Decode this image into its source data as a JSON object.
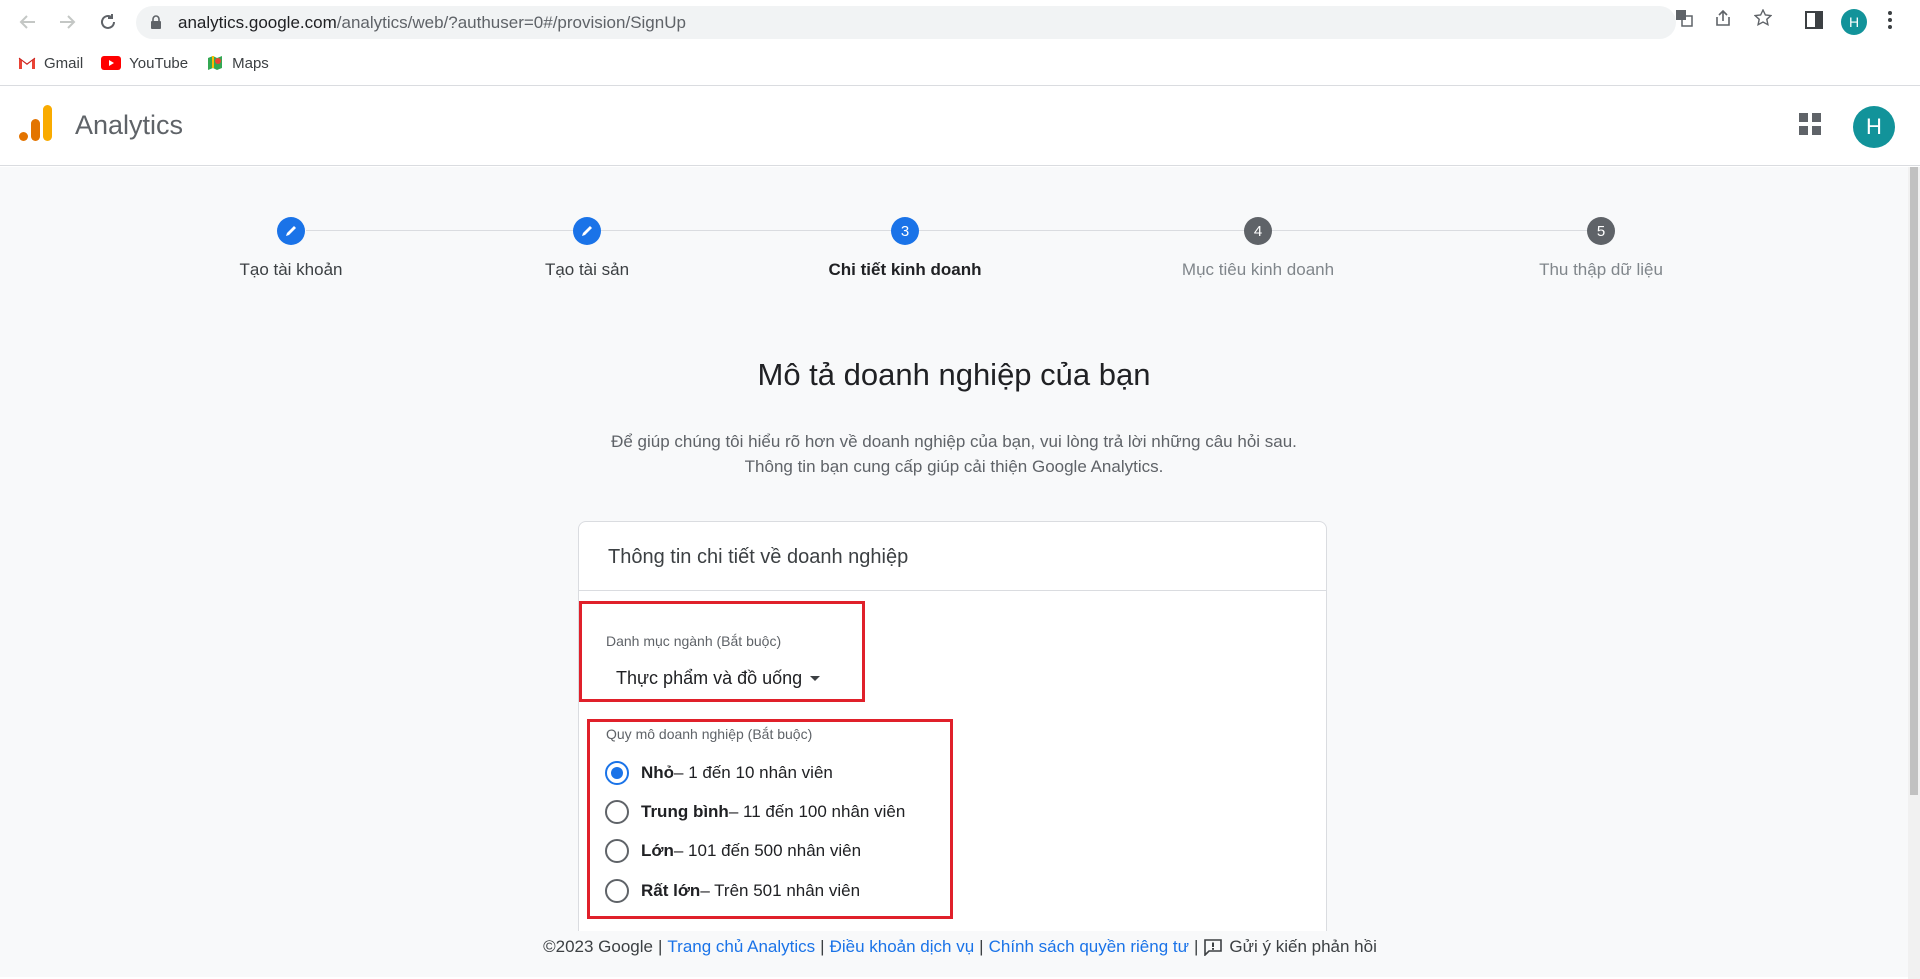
{
  "browser": {
    "url_host": "analytics.google.com",
    "url_path": "/analytics/web/?authuser=0#/provision/SignUp",
    "profile_initial": "H",
    "bookmarks": [
      {
        "label": "Gmail",
        "icon": "gmail-icon"
      },
      {
        "label": "YouTube",
        "icon": "youtube-icon"
      },
      {
        "label": "Maps",
        "icon": "maps-icon"
      }
    ]
  },
  "app": {
    "title": "Analytics",
    "avatar_initial": "H"
  },
  "stepper": {
    "steps": [
      {
        "label": "Tạo tài khoản",
        "state": "done"
      },
      {
        "label": "Tạo tài sản",
        "state": "done"
      },
      {
        "number": "3",
        "label": "Chi tiết kinh doanh",
        "state": "active"
      },
      {
        "number": "4",
        "label": "Mục tiêu kinh doanh",
        "state": "future"
      },
      {
        "number": "5",
        "label": "Thu thập dữ liệu",
        "state": "future"
      }
    ]
  },
  "page": {
    "heading": "Mô tả doanh nghiệp của bạn",
    "subtext_line1": "Để giúp chúng tôi hiểu rõ hơn về doanh nghiệp của bạn, vui lòng trả lời những câu hỏi sau.",
    "subtext_line2": "Thông tin bạn cung cấp giúp cải thiện Google Analytics."
  },
  "card": {
    "title": "Thông tin chi tiết về doanh nghiệp",
    "industry_label": "Danh mục ngành (Bắt buộc)",
    "industry_value": "Thực phẩm và đồ uống",
    "size_label": "Quy mô doanh nghiệp (Bắt buộc)",
    "size_options": [
      {
        "name": "Nhỏ",
        "detail": " – 1 đến 10 nhân viên",
        "checked": true
      },
      {
        "name": "Trung bình",
        "detail": " – 11 đến 100 nhân viên",
        "checked": false
      },
      {
        "name": "Lớn",
        "detail": " – 101 đến 500 nhân viên",
        "checked": false
      },
      {
        "name": "Rất lớn",
        "detail": " – Trên 501 nhân viên",
        "checked": false
      }
    ]
  },
  "footer": {
    "copyright": "©2023 Google",
    "links": [
      "Trang chủ Analytics",
      "Điều khoản dịch vụ",
      "Chính sách quyền riêng tư"
    ],
    "feedback": "Gửi ý kiến phản hồi"
  },
  "colors": {
    "accent": "#1a73e8",
    "highlight": "#e0202a",
    "avatar": "#12939a"
  }
}
